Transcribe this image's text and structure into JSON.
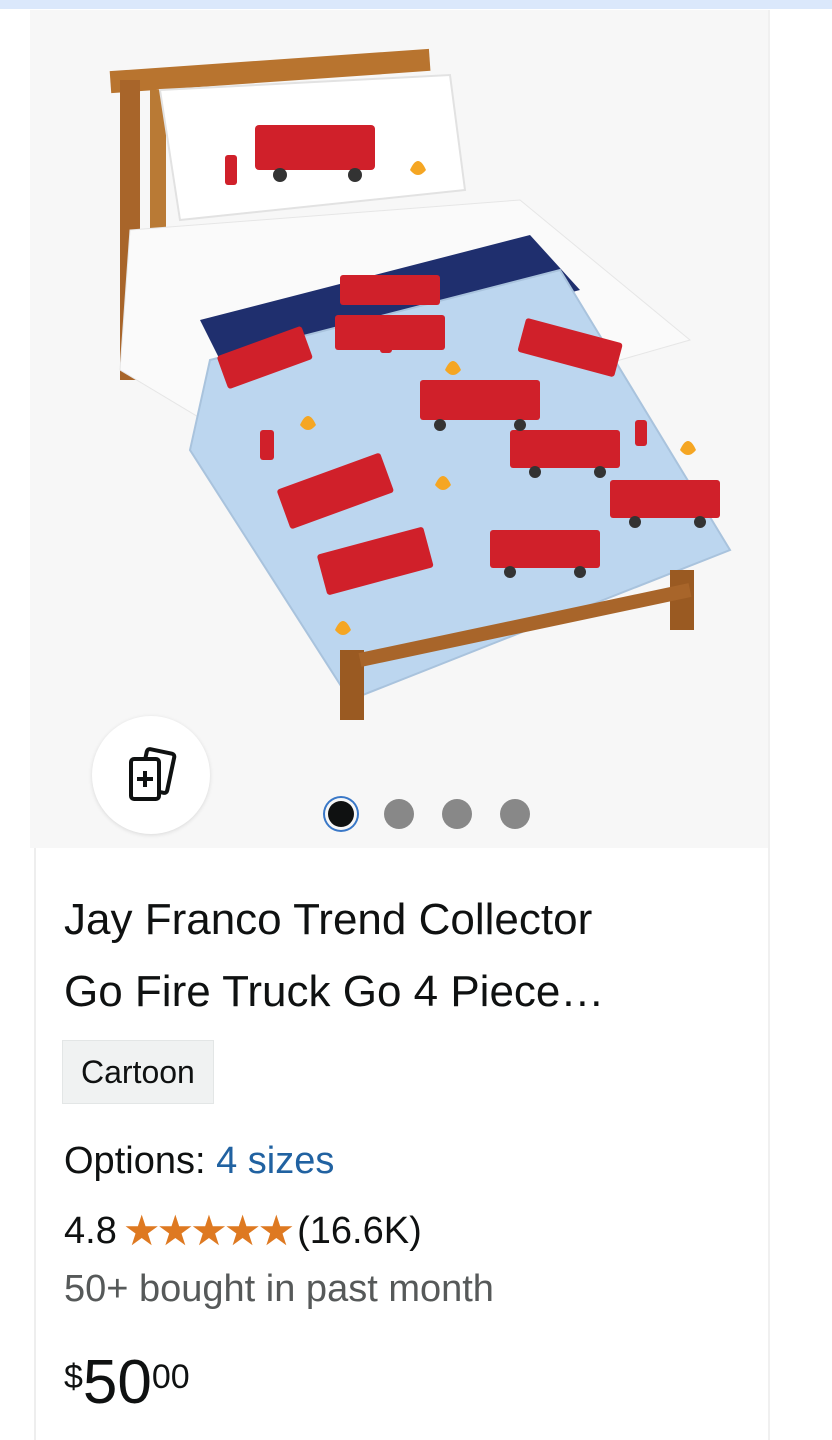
{
  "product": {
    "title_line1": "Jay Franco Trend Collector",
    "title_line2": "Go Fire Truck Go 4 Piece…",
    "badge": "Cartoon",
    "options_label": "Options:",
    "options_value": "4 sizes",
    "rating": "4.8",
    "rating_stars": 5,
    "rating_count": "(16.6K)",
    "bought": "50+ bought in past month",
    "price_symbol": "$",
    "price_whole": "50",
    "price_fraction": "00"
  },
  "carousel": {
    "total_images": 4,
    "active_index": 0
  },
  "icons": {
    "compare": "compare-add-icon",
    "star": "star-icon"
  },
  "colors": {
    "link": "#2162a1",
    "star": "#de7921",
    "text": "#0f1111",
    "muted": "#565959"
  }
}
